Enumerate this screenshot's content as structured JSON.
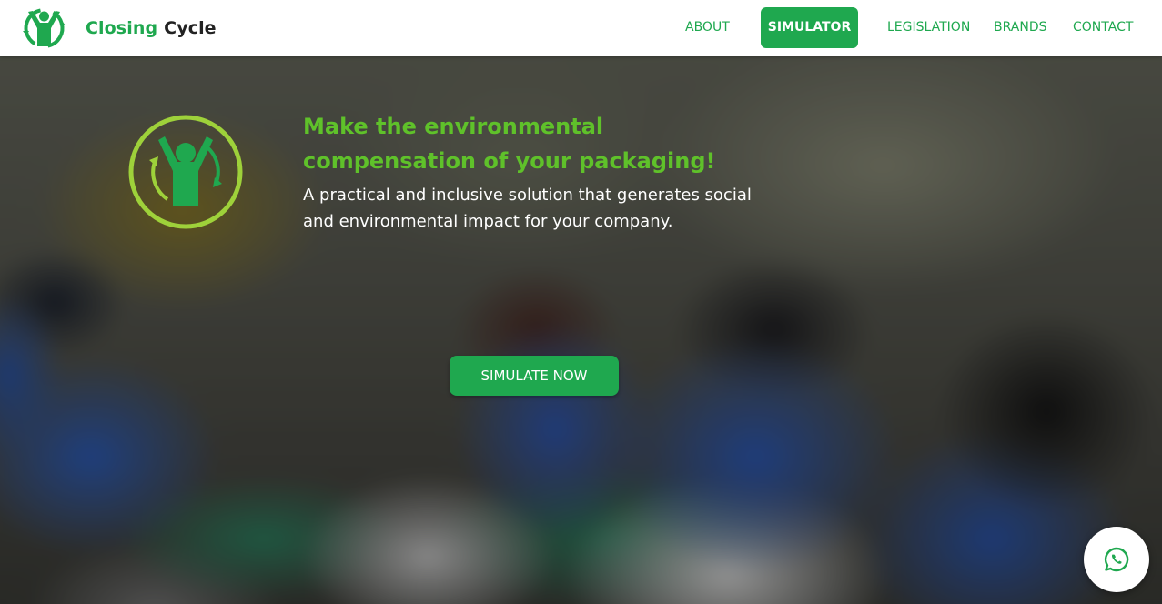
{
  "header": {
    "brand": {
      "word1": "Closing",
      "word2": "Cycle",
      "logo_icon": "recycle-person-logo-icon"
    },
    "nav": [
      {
        "label": "ABOUT",
        "active": false
      },
      {
        "label": "SIMULATOR",
        "active": true
      },
      {
        "label": "LEGISLATION",
        "active": false
      },
      {
        "label": "BRANDS",
        "active": false
      },
      {
        "label": "CONTACT",
        "active": false
      }
    ]
  },
  "hero": {
    "title": "Make the environmental compensation of your packaging!",
    "subtitle": "A practical and inclusive solution that generates social and environmental impact for your company.",
    "cta_label": "SIMULATE NOW",
    "logo_icon": "recycle-person-emblem-icon"
  },
  "chat": {
    "icon": "whatsapp-icon"
  },
  "colors": {
    "brand_green": "#1fa84f",
    "headline_green": "#5fc12a",
    "emblem_ring": "#9ed13a"
  }
}
